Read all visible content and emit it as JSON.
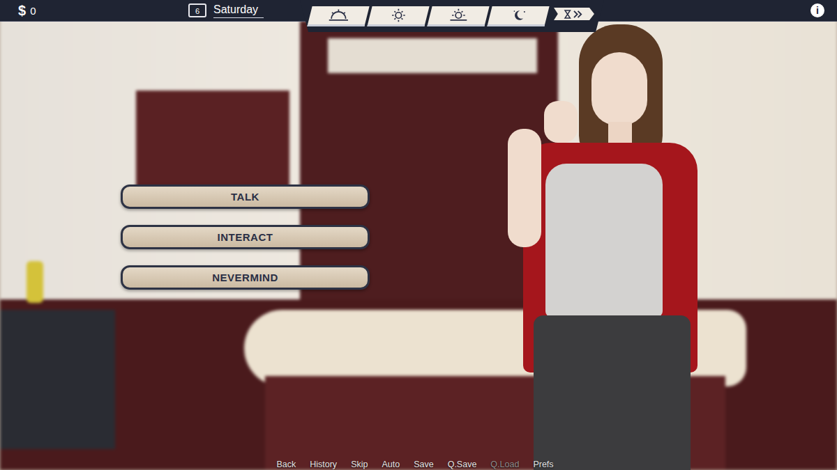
{
  "hud": {
    "money_symbol": "$",
    "money": "0",
    "day_number": "6",
    "weekday": "Saturday",
    "info": "i"
  },
  "menu": [
    {
      "label": "TALK"
    },
    {
      "label": "INTERACT"
    },
    {
      "label": "NEVERMIND"
    }
  ],
  "quick_menu": [
    {
      "label": "Back",
      "disabled": false
    },
    {
      "label": "History",
      "disabled": false
    },
    {
      "label": "Skip",
      "disabled": false
    },
    {
      "label": "Auto",
      "disabled": false
    },
    {
      "label": "Save",
      "disabled": false
    },
    {
      "label": "Q.Save",
      "disabled": false
    },
    {
      "label": "Q.Load",
      "disabled": true
    },
    {
      "label": "Prefs",
      "disabled": false
    }
  ]
}
